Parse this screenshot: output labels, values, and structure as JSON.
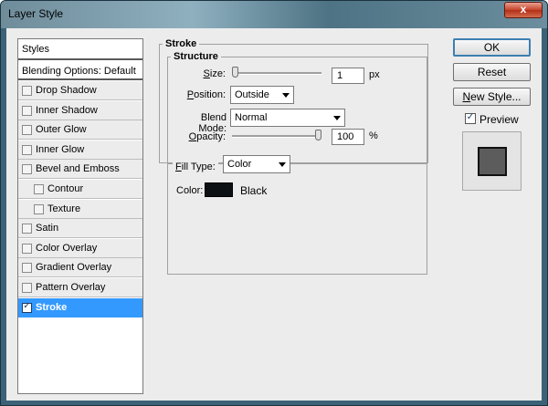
{
  "window": {
    "title": "Layer Style",
    "close_glyph": "x"
  },
  "styles_panel": {
    "header": "Styles",
    "blending_options": "Blending Options: Default",
    "items": [
      {
        "label": "Drop Shadow",
        "checked": false,
        "indent": false
      },
      {
        "label": "Inner Shadow",
        "checked": false,
        "indent": false
      },
      {
        "label": "Outer Glow",
        "checked": false,
        "indent": false
      },
      {
        "label": "Inner Glow",
        "checked": false,
        "indent": false
      },
      {
        "label": "Bevel and Emboss",
        "checked": false,
        "indent": false
      },
      {
        "label": "Contour",
        "checked": false,
        "indent": true
      },
      {
        "label": "Texture",
        "checked": false,
        "indent": true
      },
      {
        "label": "Satin",
        "checked": false,
        "indent": false
      },
      {
        "label": "Color Overlay",
        "checked": false,
        "indent": false
      },
      {
        "label": "Gradient Overlay",
        "checked": false,
        "indent": false
      },
      {
        "label": "Pattern Overlay",
        "checked": false,
        "indent": false
      },
      {
        "label": "Stroke",
        "checked": true,
        "indent": false,
        "selected": true
      }
    ]
  },
  "stroke": {
    "title": "Stroke",
    "structure_title": "Structure",
    "size": {
      "label_u": "S",
      "label_rest": "ize:",
      "value": "1",
      "unit": "px",
      "slider_fraction": 0.0
    },
    "position": {
      "label_u": "P",
      "label_rest": "osition:",
      "value": "Outside"
    },
    "blend_mode": {
      "label_pre": "Blend Mode:",
      "value": "Normal"
    },
    "opacity": {
      "label_u": "O",
      "label_rest": "pacity:",
      "value": "100",
      "unit": "%",
      "slider_fraction": 1.0
    },
    "fill_type": {
      "label_u": "F",
      "label_rest": "ill Type:",
      "value": "Color"
    },
    "color": {
      "label": "Color:",
      "name": "Black",
      "swatch_hex": "#0d1114"
    }
  },
  "buttons": {
    "ok": "OK",
    "reset": "Reset",
    "new_style_u": "N",
    "new_style_rest": "ew Style...",
    "preview_label": "Preview",
    "preview_checked": true
  }
}
